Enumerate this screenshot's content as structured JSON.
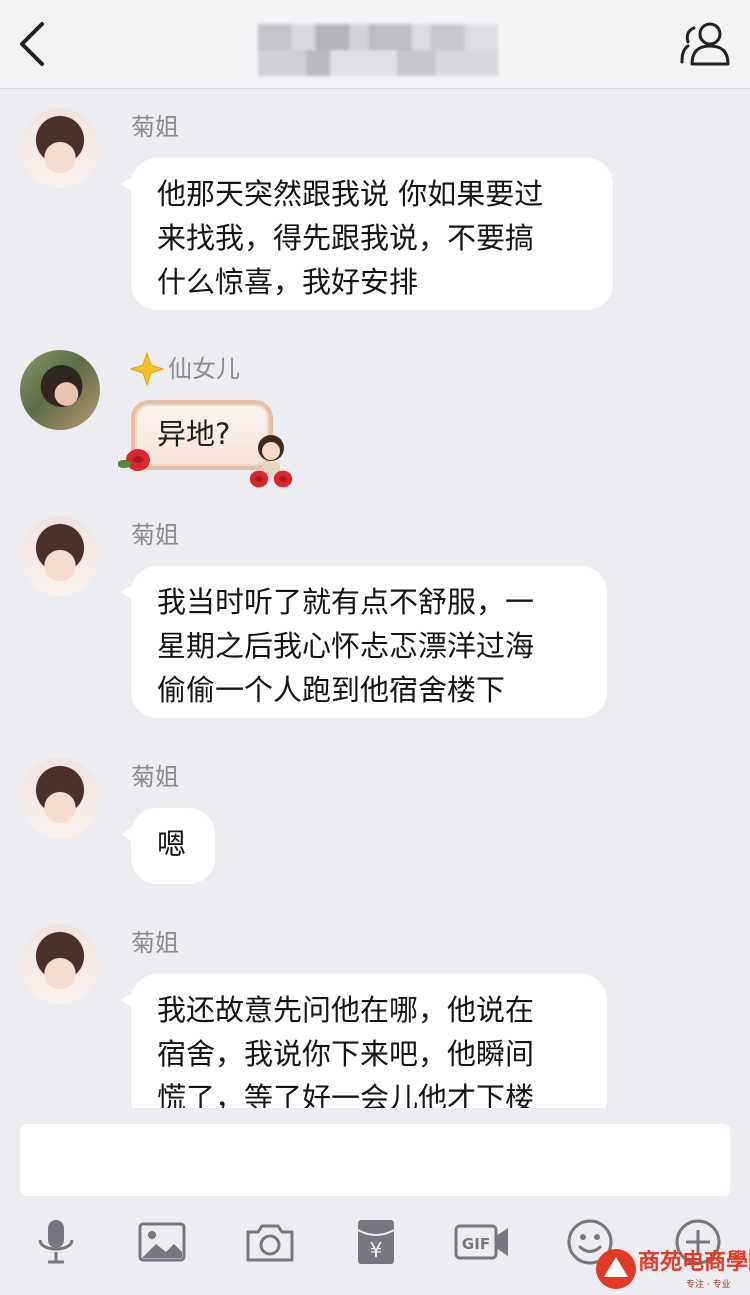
{
  "header": {
    "title": ""
  },
  "messages": [
    {
      "sender": "菊姐",
      "text": "他那天突然跟我说 你如果要过\n来找我，得先跟我说，不要搞\n什么惊喜，我好安排"
    },
    {
      "sender": "仙女儿",
      "text": "异地?"
    },
    {
      "sender": "菊姐",
      "text": "我当时听了就有点不舒服，一\n星期之后我心怀忐忑漂洋过海\n偷偷一个人跑到他宿舍楼下"
    },
    {
      "sender": "菊姐",
      "text": "嗯"
    },
    {
      "sender": "菊姐",
      "text": "我还故意先问他在哪，他说在\n宿舍，我说你下来吧，他瞬间\n慌了，等了好一会儿他才下楼"
    }
  ],
  "input": {
    "value": ""
  },
  "toolbar": {
    "icons": [
      "microphone-icon",
      "image-icon",
      "camera-icon",
      "red-packet-icon",
      "gif-icon",
      "emoji-icon",
      "plus-icon"
    ],
    "gif_label": "GIF",
    "yuan_label": "¥"
  },
  "watermark": {
    "text": "商苑电商學院",
    "sub": "专注 · 专业"
  },
  "colors": {
    "background": "#ededf1",
    "bubble": "#ffffff",
    "name": "#8b8b90",
    "icon": "#777780",
    "watermark": "#e23a26"
  }
}
